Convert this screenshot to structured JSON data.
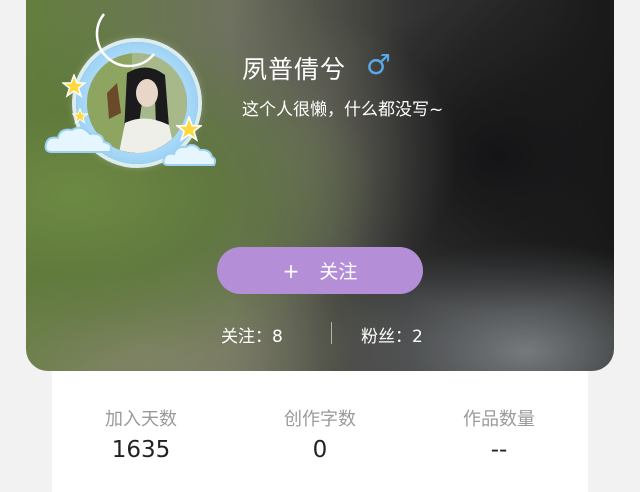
{
  "profile": {
    "name": "夙普倩兮",
    "gender_icon": "male-symbol-icon",
    "gender_symbol": "♂",
    "bio": "这个人很懒，什么都没写~"
  },
  "follow_button": {
    "icon": "plus-icon",
    "plus": "+",
    "label": "关注"
  },
  "social": {
    "following": "关注：8",
    "followers": "粉丝：2"
  },
  "metrics": [
    {
      "label": "加入天数",
      "value": "1635"
    },
    {
      "label": "创作字数",
      "value": "0"
    },
    {
      "label": "作品数量",
      "value": "--"
    }
  ],
  "colors": {
    "follow_button": "#b48fd8",
    "gender": "#5aa8e8",
    "muted_label": "#9a9a9a"
  }
}
